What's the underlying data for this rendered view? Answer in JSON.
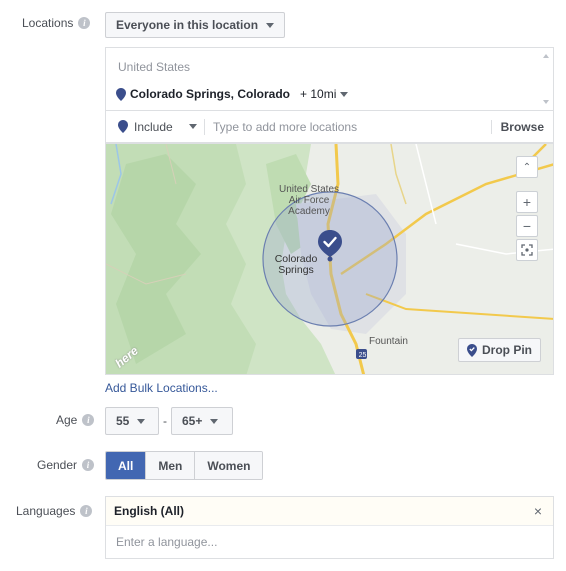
{
  "locations": {
    "label": "Locations",
    "audience_select": "Everyone in this location",
    "country": "United States",
    "selected_location": "Colorado Springs, Colorado",
    "radius": "+ 10mi",
    "include_label": "Include",
    "search_placeholder": "Type to add more locations",
    "browse_label": "Browse",
    "map": {
      "labels": {
        "academy": "United States Air Force Academy",
        "city": "Colorado Springs",
        "fountain": "Fountain",
        "highway": "25",
        "provider": "here"
      },
      "zoom_in": "+",
      "zoom_out": "−",
      "drop_pin_label": "Drop Pin"
    },
    "bulk_link": "Add Bulk Locations..."
  },
  "age": {
    "label": "Age",
    "min": "55",
    "separator": "-",
    "max": "65+"
  },
  "gender": {
    "label": "Gender",
    "options": [
      "All",
      "Men",
      "Women"
    ],
    "selected": "All"
  },
  "languages": {
    "label": "Languages",
    "selected": "English (All)",
    "clear_icon": "×",
    "placeholder": "Enter a language..."
  },
  "colors": {
    "accent": "#4267b2",
    "pin": "#3b4e8c",
    "link": "#365899"
  }
}
